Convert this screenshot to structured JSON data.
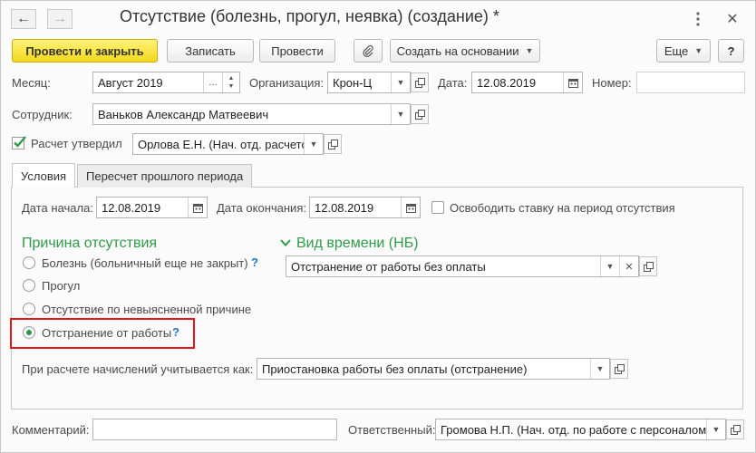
{
  "window": {
    "title": "Отсутствие (болезнь, прогул, неявка) (создание) *",
    "nav_back_icon": "arrow-left-icon",
    "nav_forward_icon": "arrow-right-icon"
  },
  "toolbar": {
    "post_close": "Провести и закрыть",
    "save": "Записать",
    "post": "Провести",
    "create_based": "Создать на основании",
    "more": "Еще",
    "help": "?"
  },
  "form": {
    "month_label": "Месяц:",
    "month_value": "Август 2019",
    "month_dots": "...",
    "org_label": "Организация:",
    "org_value": "Крон-Ц",
    "date_label": "Дата:",
    "date_value": "12.08.2019",
    "number_label": "Номер:",
    "number_value": "",
    "employee_label": "Сотрудник:",
    "employee_value": "Ваньков Александр Матвеевич",
    "approved_label": "Расчет утвердил",
    "approved_checked": true,
    "approver_value": "Орлова Е.Н. (Нач. отд. расчетов"
  },
  "tabs": [
    {
      "label": "Условия",
      "active": true
    },
    {
      "label": "Пересчет прошлого периода",
      "active": false
    }
  ],
  "conditions": {
    "start_label": "Дата начала:",
    "start_value": "12.08.2019",
    "end_label": "Дата окончания:",
    "end_value": "12.08.2019",
    "release_rate_label": "Освободить ставку на период отсутствия",
    "release_rate_checked": false,
    "reason_title": "Причина отсутствия",
    "reasons": [
      {
        "label": "Болезнь (больничный еще не закрыт)",
        "selected": false,
        "help": "?"
      },
      {
        "label": "Прогул",
        "selected": false
      },
      {
        "label": "Отсутствие по невыясненной причине",
        "selected": false
      },
      {
        "label": "Отстранение от работы",
        "selected": true,
        "help": "?"
      }
    ],
    "time_type_title": "Вид времени (НБ)",
    "time_type_value": "Отстранение от работы без оплаты",
    "calc_label": "При расчете начислений учитывается как:",
    "calc_value": "Приостановка работы без оплаты (отстранение)"
  },
  "footer": {
    "comment_label": "Комментарий:",
    "comment_value": "",
    "responsible_label": "Ответственный:",
    "responsible_value": "Громова Н.П. (Нач. отд. по работе с персоналом"
  },
  "colors": {
    "accent_green": "#2f9a48",
    "primary_button": "#f3d81a",
    "highlight_red": "#e3161c",
    "help_blue": "#2174c9"
  }
}
